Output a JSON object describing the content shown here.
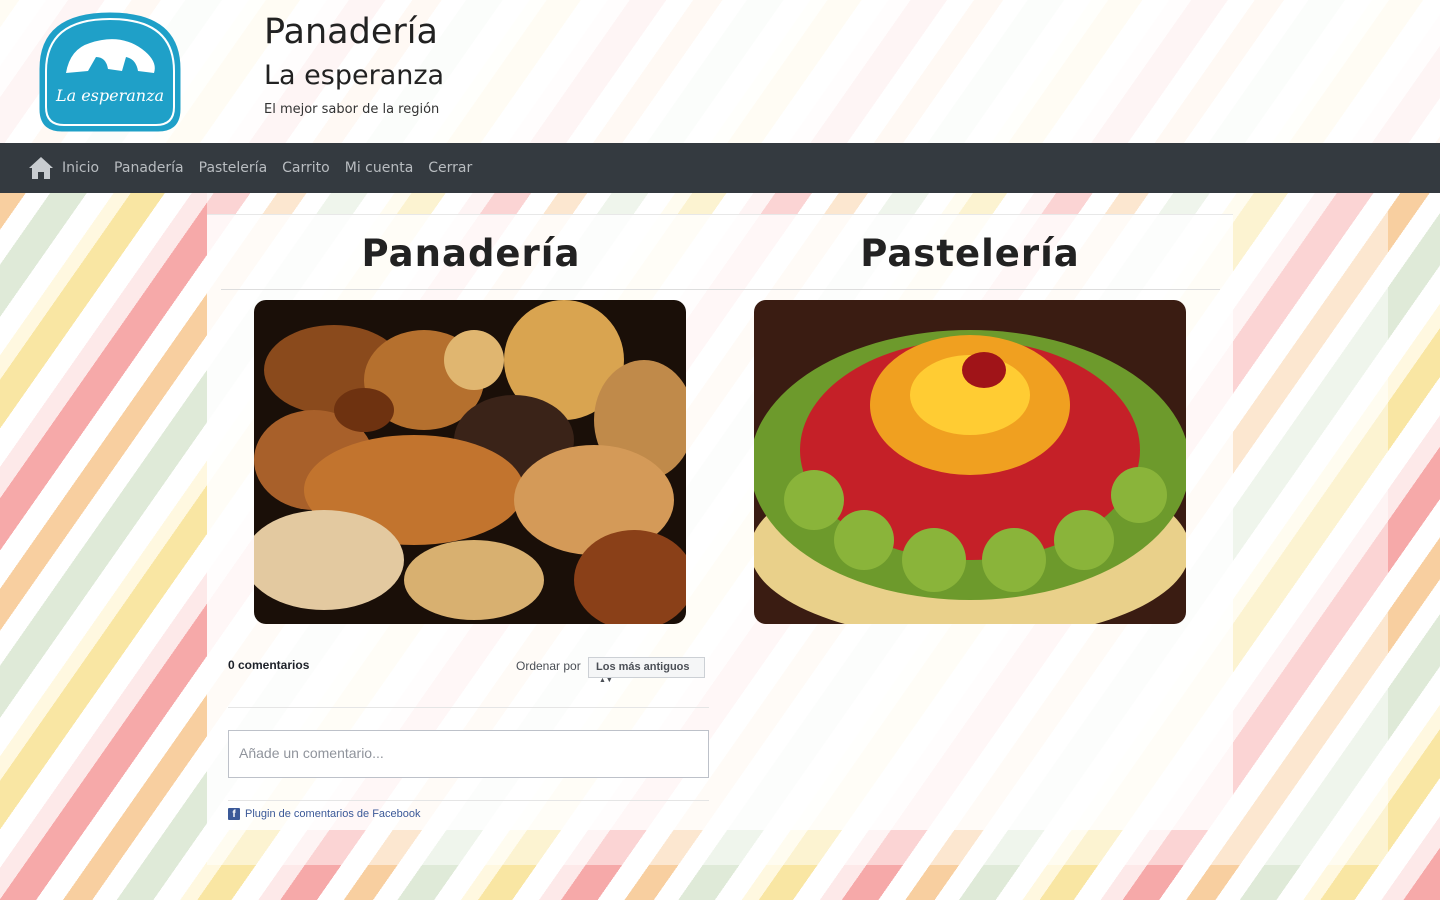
{
  "header": {
    "logo_text": "La esperanza",
    "title": "Panadería",
    "subtitle": "La esperanza",
    "tagline": "El mejor sabor de la región"
  },
  "nav": {
    "items": [
      {
        "label": "Inicio"
      },
      {
        "label": "Panadería"
      },
      {
        "label": "Pastelería"
      },
      {
        "label": "Carrito"
      },
      {
        "label": "Mi cuenta"
      },
      {
        "label": "Cerrar"
      }
    ]
  },
  "sections": [
    {
      "title": "Panadería",
      "image": "bread-pastries-image"
    },
    {
      "title": "Pastelería",
      "image": "fruit-cake-image"
    }
  ],
  "comments": {
    "count_label": "0 comentarios",
    "order_label": "Ordenar por",
    "order_selected": "Los más antiguos",
    "input_placeholder": "Añade un comentario...",
    "plugin_label": "Plugin de comentarios de Facebook"
  },
  "colors": {
    "navbar": "#343a40",
    "logo": "#1fa0c8",
    "facebook": "#3b5998"
  }
}
